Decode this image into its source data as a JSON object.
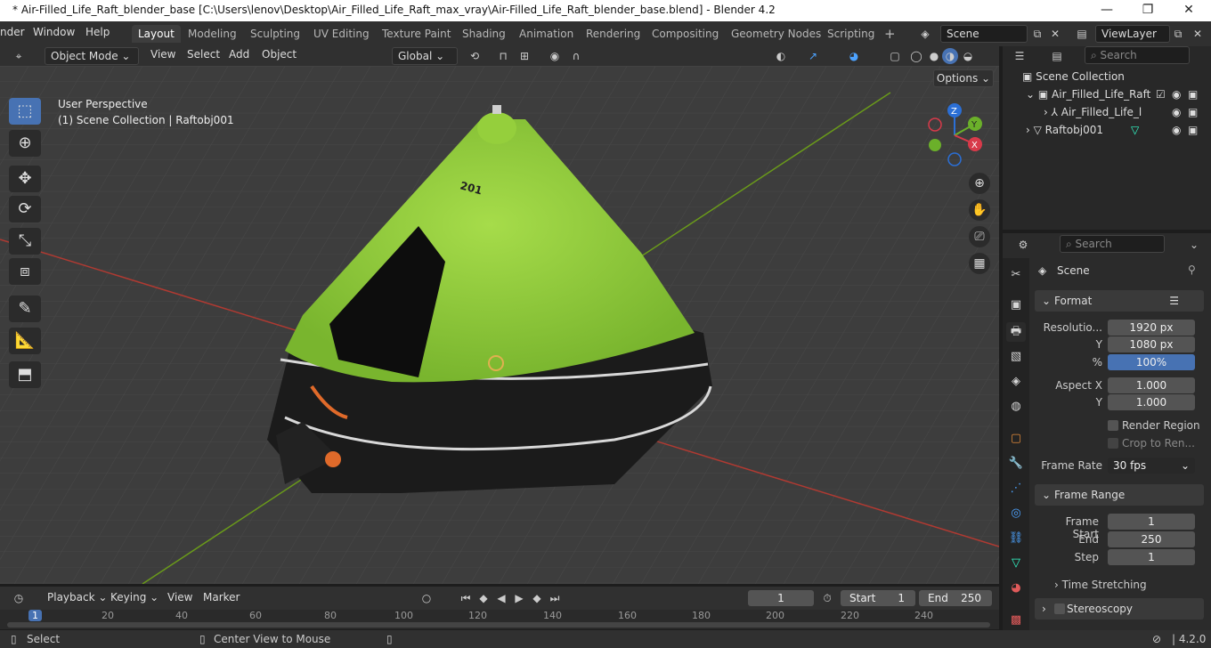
{
  "window": {
    "title": "* Air-Filled_Life_Raft_blender_base [C:\\Users\\lenov\\Desktop\\Air_Filled_Life_Raft_max_vray\\Air-Filled_Life_Raft_blender_base.blend] - Blender 4.2",
    "minimize": "—",
    "maximize": "❐",
    "close": "✕"
  },
  "menus": [
    "nder",
    "Window",
    "Help"
  ],
  "workspaces": [
    "Layout",
    "Modeling",
    "Sculpting",
    "UV Editing",
    "Texture Paint",
    "Shading",
    "Animation",
    "Rendering",
    "Compositing",
    "Geometry Nodes",
    "Scripting"
  ],
  "active_workspace": "Layout",
  "add_workspace": "+",
  "scene": {
    "name": "Scene"
  },
  "view_layer": {
    "name": "ViewLayer"
  },
  "viewport": {
    "mode": "Object Mode",
    "menus": [
      "View",
      "Select",
      "Add",
      "Object"
    ],
    "transform_orientation": "Global",
    "options_label": "Options",
    "overlay_line1": "User Perspective",
    "overlay_line2": "(1) Scene Collection | Raftobj001",
    "model_label": "201",
    "gizmo": {
      "z": "Z",
      "y": "Y",
      "x": "X"
    }
  },
  "outliner": {
    "search_placeholder": "Search",
    "root": "Scene Collection",
    "items": [
      {
        "label": "Air_Filled_Life_Raft"
      },
      {
        "label": "Air_Filled_Life_l"
      },
      {
        "label": "Raftobj001"
      }
    ]
  },
  "properties": {
    "search_placeholder": "Search",
    "context": "Scene",
    "format": {
      "title": "Format",
      "resolution_label": "Resolutio...",
      "res_x": "1920 px",
      "y_label": "Y",
      "res_y": "1080 px",
      "pct_label": "%",
      "pct": "100%",
      "aspect_x_label": "Aspect X",
      "aspect_x": "1.000",
      "aspect_y_label": "Y",
      "aspect_y": "1.000",
      "render_region": "Render Region",
      "crop": "Crop to Ren...",
      "frame_rate_label": "Frame Rate",
      "frame_rate": "30 fps"
    },
    "frame_range": {
      "title": "Frame Range",
      "start_label": "Frame Start",
      "start": "1",
      "end_label": "End",
      "end": "250",
      "step_label": "Step",
      "step": "1"
    },
    "time_stretching": "Time Stretching",
    "stereoscopy": "Stereoscopy"
  },
  "timeline": {
    "menus": [
      "Playback",
      "Keying",
      "View",
      "Marker"
    ],
    "current_frame": "1",
    "start_label": "Start",
    "start": "1",
    "end_label": "End",
    "end": "250",
    "ticks": [
      "1",
      "20",
      "40",
      "60",
      "80",
      "100",
      "120",
      "140",
      "160",
      "180",
      "200",
      "220",
      "240"
    ]
  },
  "statusbar": {
    "select": "Select",
    "center": "Center View to Mouse",
    "version": "4.2.0"
  },
  "colors": {
    "accent": "#4772b3",
    "tent": "#8fcf3a",
    "tube": "#1b1b1b",
    "grid_x": "#c0392b",
    "grid_y": "#6a9a1a"
  }
}
